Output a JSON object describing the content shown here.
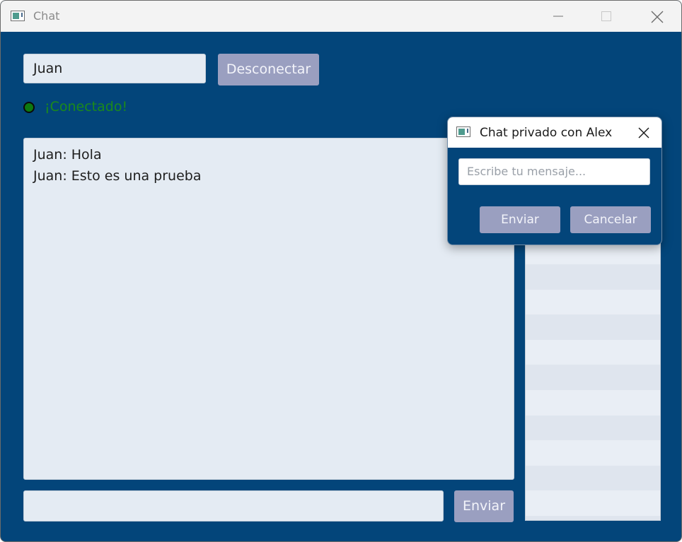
{
  "window": {
    "title": "Chat"
  },
  "header": {
    "username_value": "Juan",
    "disconnect_label": "Desconectar"
  },
  "status": {
    "text": "¡Conectado!",
    "color": "#0d7a10"
  },
  "messages": [
    "Juan: Hola",
    "Juan: Esto es una prueba"
  ],
  "composer": {
    "input_value": "",
    "send_label": "Enviar"
  },
  "private_dialog": {
    "title": "Chat privado con Alex",
    "input_placeholder": "Escribe tu mensaje...",
    "send_label": "Enviar",
    "cancel_label": "Cancelar"
  },
  "colors": {
    "background": "#03457a",
    "button": "#9a9fc0",
    "field": "#e4ebf3"
  }
}
